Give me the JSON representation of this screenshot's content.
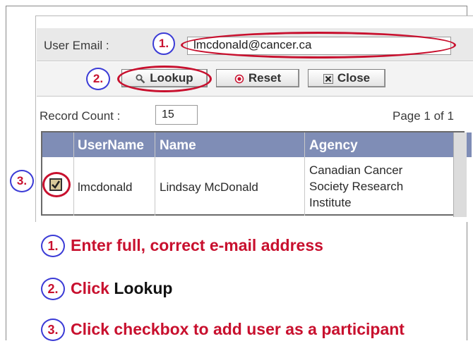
{
  "form": {
    "email_label": "User Email :",
    "email_value": "lmcdonald@cancer.ca",
    "lookup_label": "Lookup",
    "reset_label": "Reset",
    "close_label": "Close",
    "record_count_label": "Record Count :",
    "record_count_value": "15",
    "page_info": "Page 1 of 1"
  },
  "table": {
    "headers": [
      "UserName",
      "Name",
      "Agency"
    ],
    "rows": [
      {
        "username": "lmcdonald",
        "name": "Lindsay McDonald",
        "agency_lines": [
          "Canadian Cancer",
          "Society Research",
          "Institute"
        ],
        "checked": true
      }
    ]
  },
  "callouts": [
    "1.",
    "2.",
    "3."
  ],
  "instructions": [
    {
      "number": "1.",
      "text": "Enter full, correct e-mail address"
    },
    {
      "number": "2.",
      "text": "Click",
      "emphasis": "Lookup"
    },
    {
      "number": "3.",
      "text": "Click checkbox to add user as a participant"
    }
  ],
  "colors": {
    "accent_red": "#c8102e",
    "callout_blue": "#3b3bd6",
    "grid_header": "#7f8db6"
  },
  "icons": [
    "magnifier-icon",
    "radio-dot-icon",
    "x-close-icon",
    "checkbox-checked-icon"
  ]
}
